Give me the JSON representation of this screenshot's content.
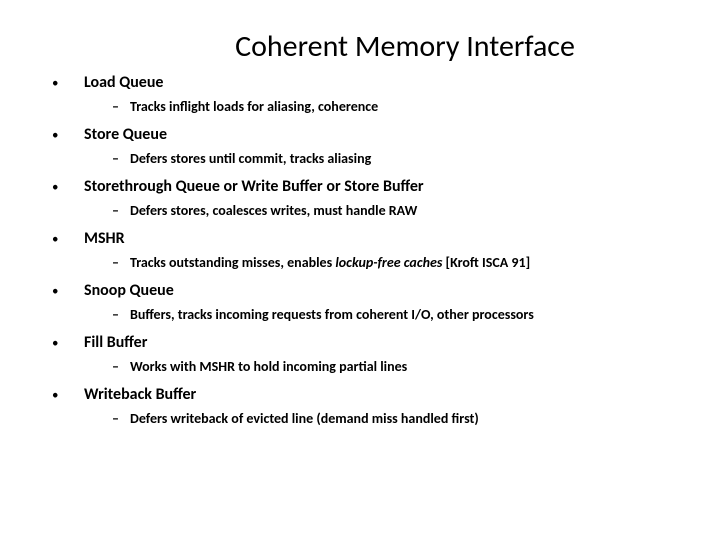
{
  "title": "Coherent Memory Interface",
  "items": [
    {
      "label": "Load Queue",
      "sub": "Tracks inflight loads for aliasing, coherence"
    },
    {
      "label": "Store Queue",
      "sub": "Defers stores until commit, tracks aliasing"
    },
    {
      "label": "Storethrough Queue or Write Buffer or Store Buffer",
      "sub": "Defers stores, coalesces writes, must handle RAW"
    },
    {
      "label": "MSHR",
      "sub_pre": "Tracks outstanding misses, enables ",
      "sub_ital": "lockup-free caches",
      "sub_post": " [Kroft ISCA 91]"
    },
    {
      "label": "Snoop Queue",
      "sub": "Buffers, tracks incoming requests from coherent I/O, other processors"
    },
    {
      "label": "Fill Buffer",
      "sub": "Works with MSHR to hold incoming partial lines"
    },
    {
      "label": "Writeback Buffer",
      "sub": "Defers writeback of evicted line (demand miss handled first)"
    }
  ],
  "glyphs": {
    "bullet": "•",
    "dash": "–"
  }
}
